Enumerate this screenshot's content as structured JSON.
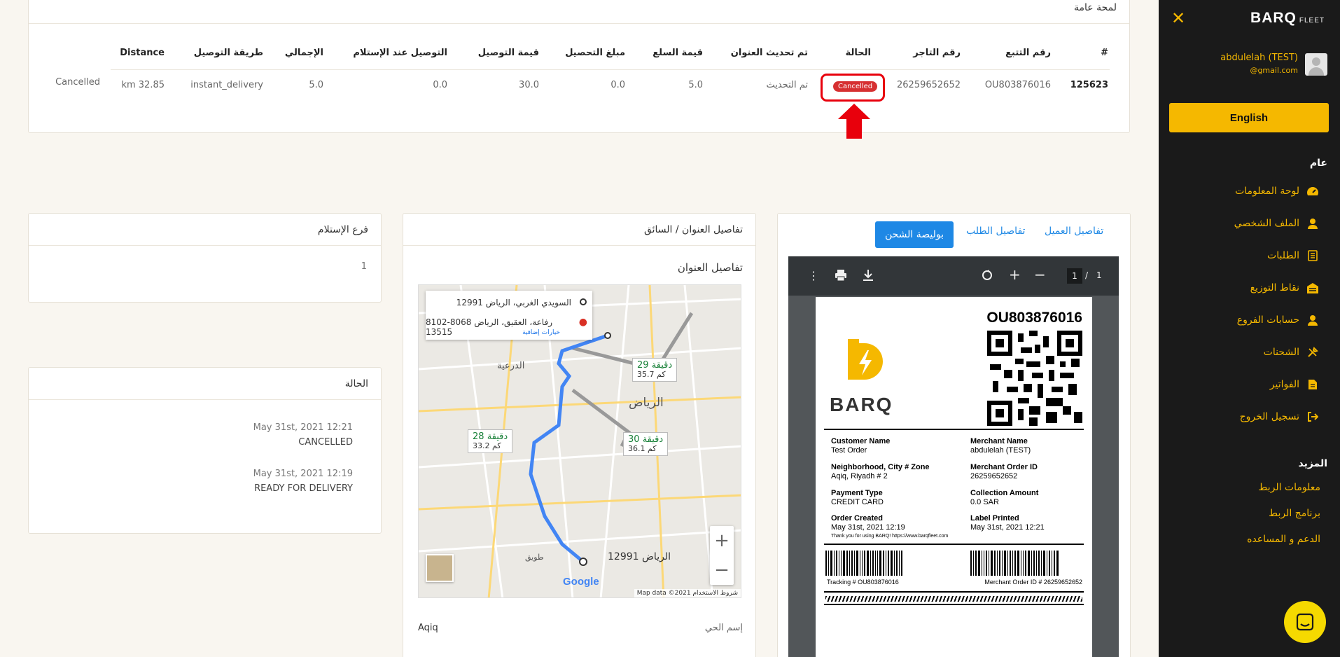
{
  "sidebar": {
    "logo_main": "BARQ",
    "logo_sub": "FLEET",
    "user_name": "abdulelah (TEST)",
    "user_email": "@gmail.com",
    "language_button": "English",
    "section_general": "عام",
    "items": [
      {
        "label": "لوحة المعلومات",
        "icon": "dashboard-gauge-icon"
      },
      {
        "label": "الملف الشخصي",
        "icon": "user-icon"
      },
      {
        "label": "الطلبات",
        "icon": "orders-list-icon"
      },
      {
        "label": "نقاط التوزيع",
        "icon": "warehouse-icon"
      },
      {
        "label": "حسابات الفروع",
        "icon": "branch-user-icon"
      },
      {
        "label": "الشحنات",
        "icon": "shipments-tools-icon"
      },
      {
        "label": "الفواتير",
        "icon": "invoice-icon"
      },
      {
        "label": "تسجيل الخروج",
        "icon": "logout-icon"
      }
    ],
    "section_more": "المزيد",
    "more_items": [
      "معلومات الربط",
      "برنامج الربط",
      "الدعم و المساعده"
    ]
  },
  "overview": {
    "title": "لمحة عامة",
    "headers": {
      "id": "#",
      "tracking": "رقم التتبع",
      "merchant_no": "رقم التاجر",
      "status": "الحالة",
      "address_updated": "تم تحديث العنوان",
      "goods_value": "قيمة السلع",
      "collection": "مبلغ التحصيل",
      "delivery_value": "قيمة التوصيل",
      "cod": "التوصيل عند الإستلام",
      "total": "الإجمالي",
      "method": "طريقة التوصيل",
      "distance": "Distance"
    },
    "row": {
      "id": "125623",
      "tracking": "OU803876016",
      "merchant_no": "26259652652",
      "status_badge": "Cancelled",
      "address_updated": "تم التحديث",
      "goods_value": "5.0",
      "collection": "0.0",
      "delivery_value": "30.0",
      "cod": "0.0",
      "total": "5.0",
      "method": "instant_delivery",
      "distance": "km 32.85",
      "status_text": "Cancelled"
    }
  },
  "shipping": {
    "tabs": [
      "تفاصيل العميل",
      "تفاصيل الطلب"
    ],
    "active_tab": "بوليصة الشحن",
    "pdf_page": "1",
    "pdf_total": "1",
    "label": {
      "tracking": "OU803876016",
      "brand": "BARQ",
      "customer_name_label": "Customer Name",
      "customer_name": "Test Order",
      "merchant_name_label": "Merchant Name",
      "merchant_name": "abdulelah (TEST)",
      "neighborhood_label": "Neighborhood, City # Zone",
      "neighborhood": "Aqiq, Riyadh # 2",
      "merchant_order_label": "Merchant Order ID",
      "merchant_order": "26259652652",
      "payment_label": "Payment Type",
      "payment": "CREDIT CARD",
      "collection_label": "Collection Amount",
      "collection": "0.0 SAR",
      "created_label": "Order Created",
      "created": "May 31st, 2021 12:19",
      "printed_label": "Label Printed",
      "printed": "May 31st, 2021 12:21",
      "thanks": "Thank you for using BARQ! https://www.barqfleet.com",
      "tracking_footer": "Tracking # OU803876016",
      "merchant_footer": "Merchant Order ID # 26259652652"
    }
  },
  "address": {
    "title": "تفاصيل العنوان / السائق",
    "subtitle": "تفاصيل العنوان",
    "map": {
      "origin": "السويدي الغربي، الرياض 12991",
      "destination": "8102-8068 رفاعة، العقيق، الرياض 13515",
      "more_options": "خيارات إضافية",
      "routes": [
        {
          "time": "29 دقيقة",
          "dist": "35.7 كم"
        },
        {
          "time": "28 دقيقة",
          "dist": "33.2 كم"
        },
        {
          "time": "30 دقيقة",
          "dist": "36.1 كم"
        }
      ],
      "places": [
        "الدرعية",
        "الرياض",
        "الرياض 12991",
        "طويق"
      ],
      "footer": "Map data ©2021   شروط الاستخدام",
      "google": "Google"
    },
    "district_label": "إسم الحي",
    "district_value": "Aqiq"
  },
  "branch": {
    "title": "فرع الإستلام",
    "value": "1"
  },
  "status": {
    "title": "الحالة",
    "events": [
      {
        "date": "May 31st, 2021 12:21",
        "status": "CANCELLED"
      },
      {
        "date": "May 31st, 2021 12:19",
        "status": "READY FOR DELIVERY"
      }
    ]
  },
  "colors": {
    "accent": "#f5b800",
    "sidebar_bg": "#1a1a1a",
    "link_blue": "#1e88e5",
    "cancel_red": "#d63031",
    "page_bg": "#f9f6f0"
  }
}
